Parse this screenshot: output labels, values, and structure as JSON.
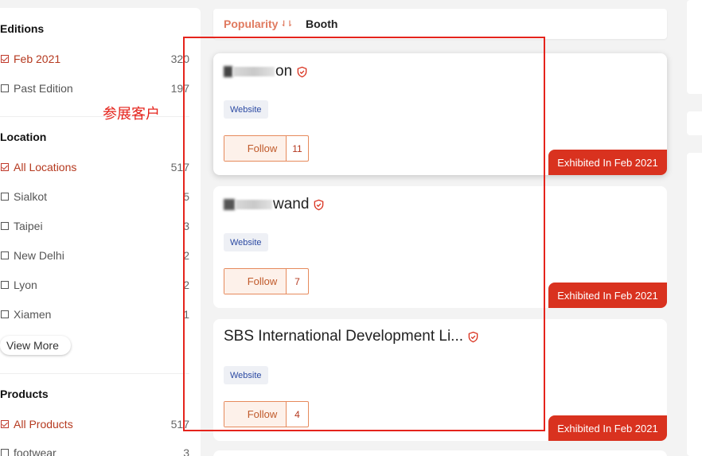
{
  "filters": {
    "editions": {
      "title": "Editions",
      "items": [
        {
          "label": "Feb 2021",
          "count": "320",
          "checked": true
        },
        {
          "label": "Past Edition",
          "count": "197",
          "checked": false
        }
      ]
    },
    "location": {
      "title": "Location",
      "items": [
        {
          "label": "All Locations",
          "count": "517",
          "checked": true
        },
        {
          "label": "Sialkot",
          "count": "5",
          "checked": false
        },
        {
          "label": "Taipei",
          "count": "3",
          "checked": false
        },
        {
          "label": "New Delhi",
          "count": "2",
          "checked": false
        },
        {
          "label": "Lyon",
          "count": "2",
          "checked": false
        },
        {
          "label": "Xiamen",
          "count": "1",
          "checked": false
        }
      ],
      "view_more": "View More"
    },
    "products": {
      "title": "Products",
      "items": [
        {
          "label": "All Products",
          "count": "517",
          "checked": true
        },
        {
          "label": "footwear",
          "count": "3",
          "checked": false
        }
      ]
    }
  },
  "sort": {
    "popularity": "Popularity",
    "popularity_icon": "sort-down-icon",
    "booth": "Booth"
  },
  "exhibitors": [
    {
      "name_visible": "on",
      "tag": "Website",
      "follow_label": "Follow",
      "follow_count": "11",
      "badge": "Exhibited In Feb 2021"
    },
    {
      "name_visible": "wand",
      "tag": "Website",
      "follow_label": "Follow",
      "follow_count": "7",
      "badge": "Exhibited In Feb 2021"
    },
    {
      "name_visible": "SBS International Development Li...",
      "tag": "Website",
      "follow_label": "Follow",
      "follow_count": "4",
      "badge": "Exhibited In Feb 2021"
    }
  ],
  "annotation": {
    "text": "参展客户",
    "color": "#e5241c"
  },
  "colors": {
    "accent": "#b5391f",
    "badge": "#d9321f",
    "sort_active": "#e07a5f"
  }
}
